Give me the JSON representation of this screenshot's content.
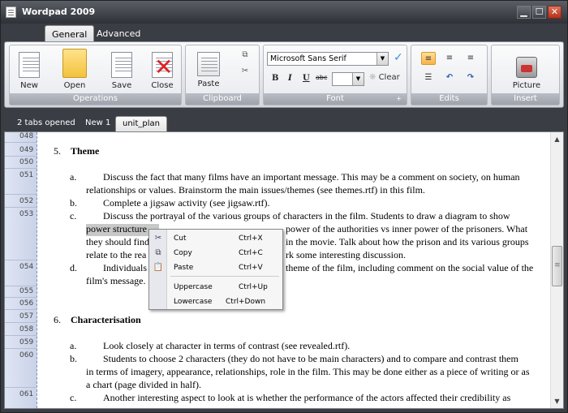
{
  "window": {
    "title": "Wordpad 2009",
    "min": "▁",
    "max": "☐",
    "close": "✕"
  },
  "ribbon_tabs": [
    "General",
    "Advanced"
  ],
  "groups": {
    "operations": {
      "label": "Operations",
      "new": "New",
      "open": "Open",
      "save": "Save",
      "close": "Close"
    },
    "clipboard": {
      "label": "Clipboard",
      "paste": "Paste"
    },
    "font": {
      "label": "Font",
      "family": "Microsoft Sans Serif",
      "bold": "B",
      "italic": "I",
      "underline": "U",
      "strike": "abc",
      "clear": "Clear"
    },
    "edits": {
      "label": "Edits"
    },
    "insert": {
      "label": "Insert",
      "picture": "Picture"
    }
  },
  "doc_tabs": {
    "count": "2 tabs opened",
    "tabs": [
      "New 1",
      "unit_plan"
    ],
    "active": "unit_plan"
  },
  "editor": {
    "line_numbers": [
      "048",
      "049",
      "050",
      "051",
      "052",
      "053",
      "054",
      "055",
      "056",
      "057",
      "058",
      "059",
      "060",
      "061"
    ],
    "lines": [
      "5.",
      "Theme",
      "a.",
      "Discuss the fact that many films have an important message.  This may be a comment on society, on human",
      "relationships or values.  Brainstorm the main issues/themes (see themes.rtf) in this film.",
      "b.",
      "Complete a jigsaw activity (see jigsaw.rtf).",
      "c.",
      "Discuss the portrayal of the various groups of characters in the film. Students to draw a diagram to show",
      "power structure",
      "power of the authorities vs inner power of the prisoners.  What",
      "they should find",
      "in the movie. Talk about how the prison and its various groups",
      "relate to the rea",
      "rk some interesting discussion.",
      "d.",
      "Individuals",
      "theme of the film, including comment on the social value of the",
      "film's message.",
      "6.",
      "Characterisation",
      "a.",
      "Look closely at character in terms of contrast (see revealed.rtf).",
      "b.",
      "Students to choose 2 characters (they do not have to be main characters) and to compare and contrast them",
      "in terms of imagery, appearance, relationships, role in the film. This may be done either as a piece of writing or as",
      "a chart (page divided in half).",
      "c.",
      "Another interesting aspect to look at is whether the performance of the actors affected their credibility as"
    ]
  },
  "context_menu": {
    "items": [
      {
        "label": "Cut",
        "key": "Ctrl+X"
      },
      {
        "label": "Copy",
        "key": "Ctrl+C"
      },
      {
        "label": "Paste",
        "key": "Ctrl+V"
      },
      {
        "label": "Uppercase",
        "key": "Ctrl+Up"
      },
      {
        "label": "Lowercase",
        "key": "Ctrl+Down"
      }
    ]
  },
  "colors": {
    "chrome": "#3a3d44",
    "accent": "#f9b24a",
    "selection": "#c8c8c8"
  }
}
